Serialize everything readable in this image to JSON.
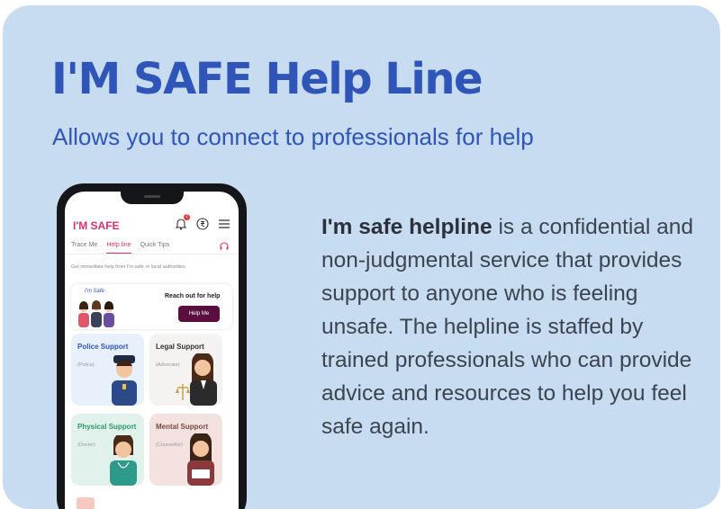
{
  "hero": {
    "title": "I'M SAFE Help Line",
    "subtitle": "Allows you to connect to professionals for help"
  },
  "description": {
    "bold": "I'm safe helpline",
    "rest": " is a confidential and non-judgmental service that provides support to anyone who is feeling unsafe. The helpline is staffed by trained professionals who can provide advice and resources to help you feel safe again."
  },
  "app": {
    "brand": "I'M SAFE",
    "notification_count": "2",
    "tabs": [
      "Trace Me",
      "Help line",
      "Quick Tips"
    ],
    "hint": "Get immediate help from I'm safe or local authorities",
    "banner": {
      "logo_text": "I'm Safe",
      "text": "Reach out for help",
      "button": "Help Me"
    },
    "tiles": [
      {
        "label": "Police Support",
        "sub": "(Police)",
        "color": "#2f55b8"
      },
      {
        "label": "Legal Support",
        "sub": "(Advocate)",
        "color": "#333333"
      },
      {
        "label": "Physical Support",
        "sub": "(Doctor)",
        "color": "#2a9a68"
      },
      {
        "label": "Mental Support",
        "sub": "(Counsellor)",
        "color": "#7a4a40"
      }
    ]
  },
  "colors": {
    "card_bg": "#c7dcf0",
    "accent": "#2f55b8",
    "brand_pink": "#d6336c",
    "button_maroon": "#5a0e3e"
  }
}
